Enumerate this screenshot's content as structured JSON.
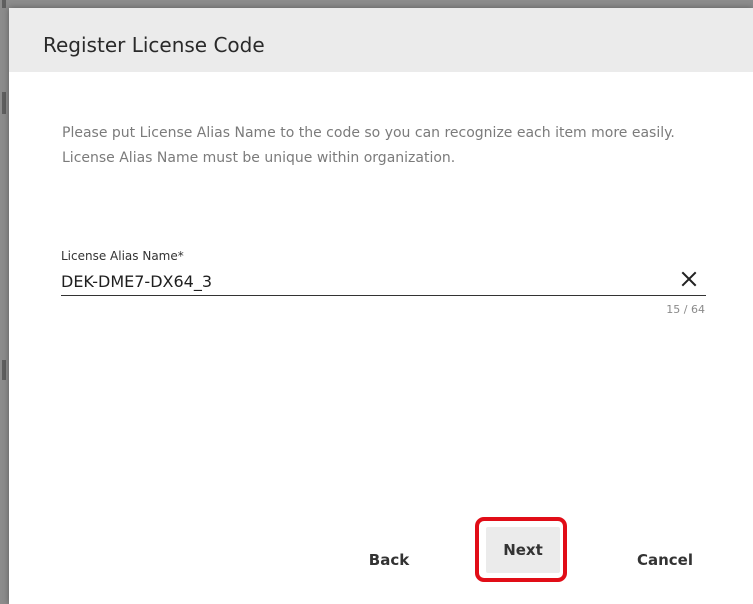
{
  "dialog": {
    "title": "Register License Code",
    "description_line1": "Please put License Alias Name to the code so you can recognize each item more easily.",
    "description_line2": "License Alias Name must be unique within organization."
  },
  "field": {
    "label": "License Alias Name*",
    "value": "DEK-DME7-DX64_3",
    "counter": "15 / 64",
    "clear_icon": "close-icon"
  },
  "buttons": {
    "back": "Back",
    "next": "Next",
    "cancel": "Cancel"
  },
  "colors": {
    "highlight": "#e10d17",
    "header_bg": "#ebebeb",
    "description_text": "#7b7b7b"
  }
}
